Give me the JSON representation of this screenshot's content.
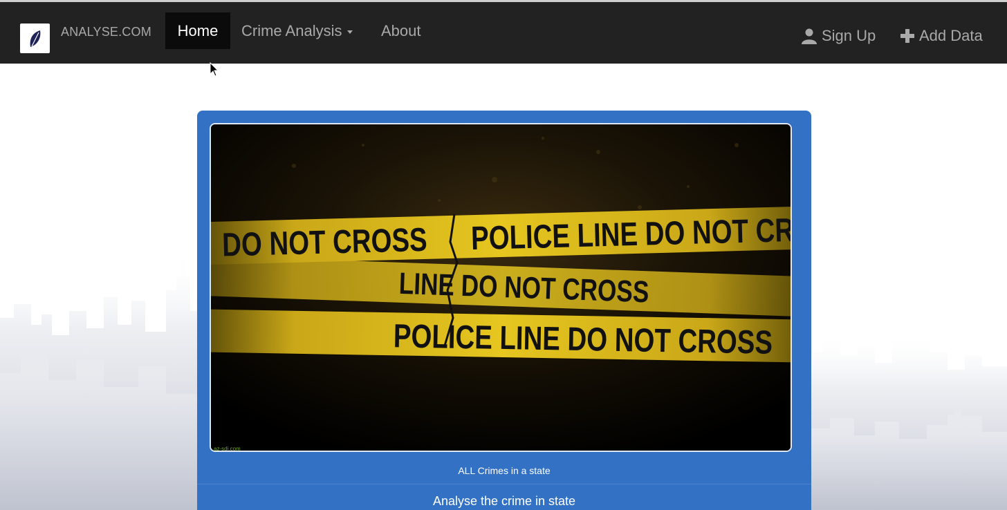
{
  "navbar": {
    "brand_name": "ANALYSE.COM",
    "items": [
      {
        "label": "Home",
        "active": true
      },
      {
        "label": "Crime Analysis",
        "dropdown": true
      },
      {
        "label": "About"
      }
    ],
    "right_items": [
      {
        "label": "Sign Up",
        "icon": "user-icon"
      },
      {
        "label": "Add Data",
        "icon": "plus-icon"
      }
    ]
  },
  "carousel": {
    "slide_image": {
      "tape_text": [
        "DO NOT CROSS",
        "POLICE LINE DO NOT CROSS",
        "LINE DO NOT CROSS",
        "POLICE LINE DO NOT CROSS"
      ],
      "watermark": "az-sdj.com"
    },
    "caption_small": "ALL Crimes in a state",
    "caption_large": "Analyse the crime in state"
  },
  "colors": {
    "navbar_bg": "#222222",
    "panel_bg": "#3371c4",
    "tape_yellow": "#e3c21b"
  }
}
